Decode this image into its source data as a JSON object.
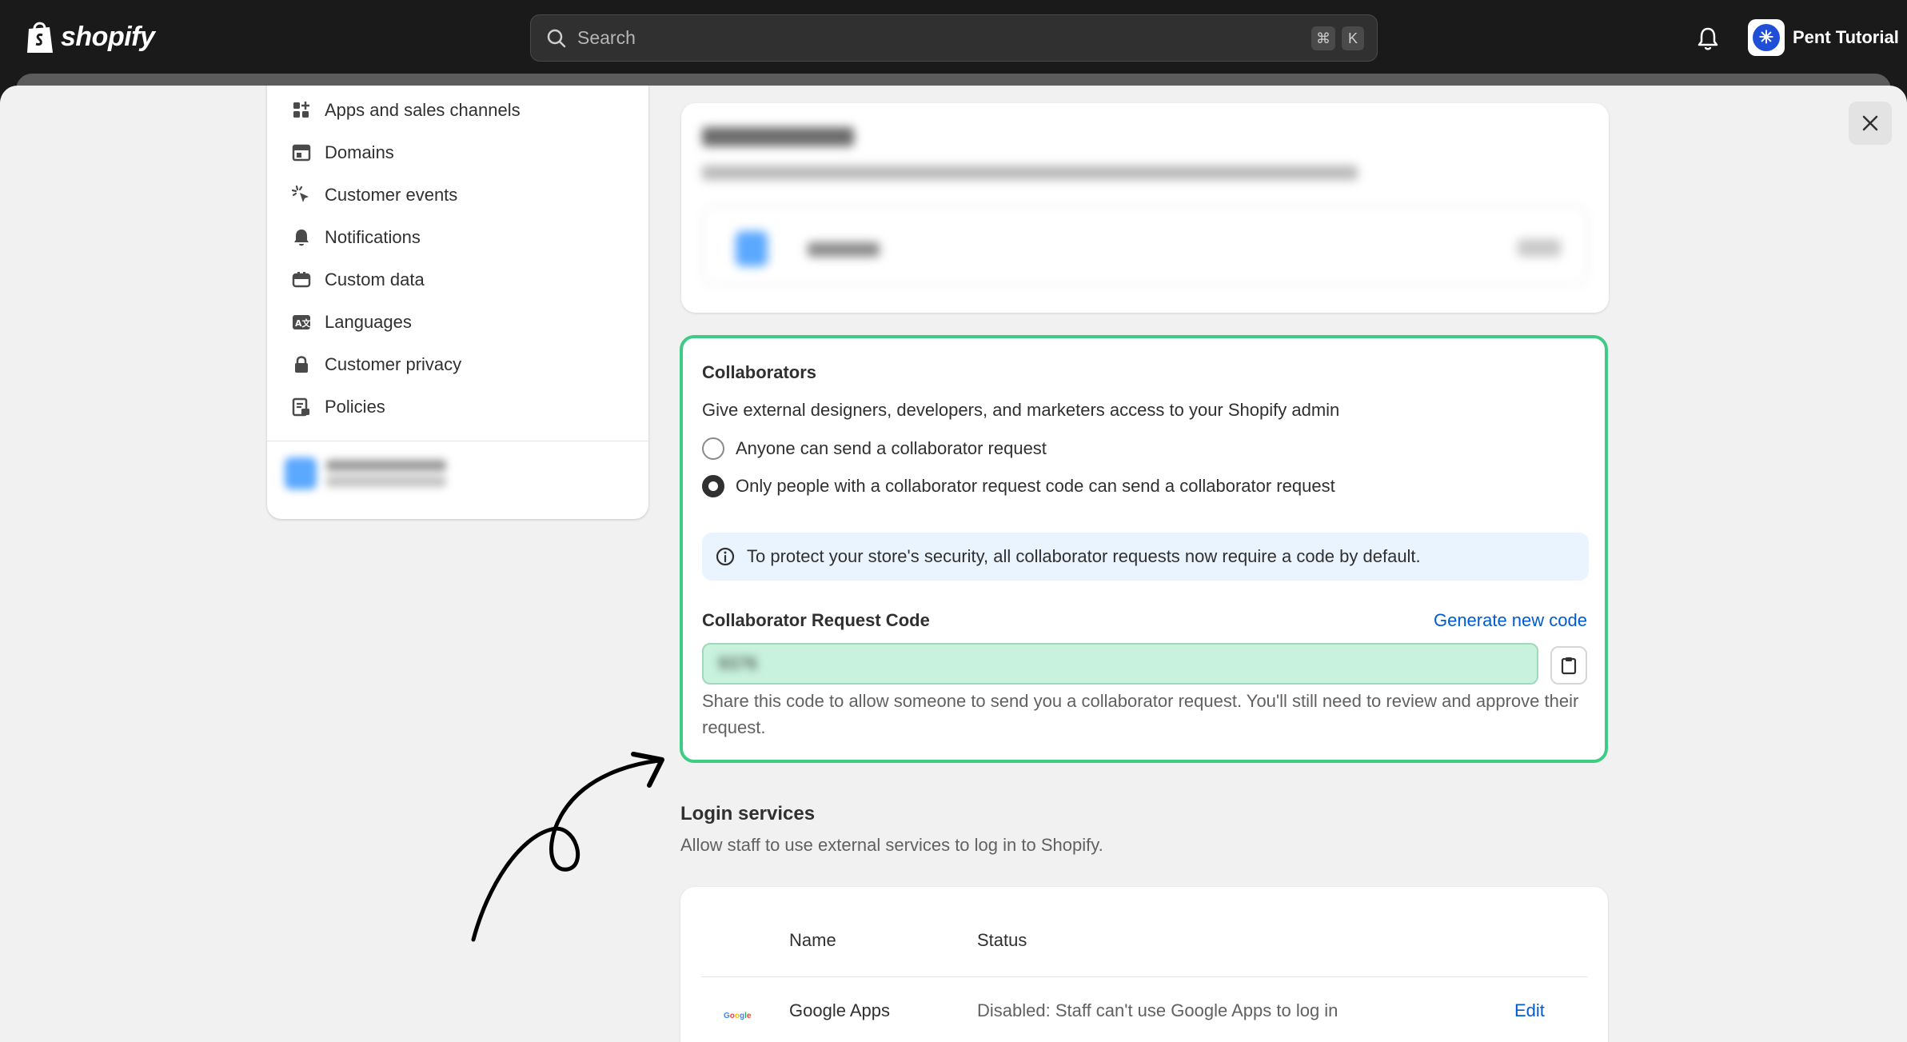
{
  "topbar": {
    "logo_text": "shopify",
    "search_placeholder": "Search",
    "shortcut_keys": [
      "⌘",
      "K"
    ],
    "store_name": "Pent Tutorial"
  },
  "sidebar": {
    "items": [
      {
        "label": "Apps and sales channels",
        "icon": "apps-icon"
      },
      {
        "label": "Domains",
        "icon": "domains-icon"
      },
      {
        "label": "Customer events",
        "icon": "cursor-click-icon"
      },
      {
        "label": "Notifications",
        "icon": "bell-icon"
      },
      {
        "label": "Custom data",
        "icon": "database-icon"
      },
      {
        "label": "Languages",
        "icon": "language-icon"
      },
      {
        "label": "Customer privacy",
        "icon": "lock-icon"
      },
      {
        "label": "Policies",
        "icon": "policy-icon"
      }
    ]
  },
  "collaborators": {
    "title": "Collaborators",
    "description": "Give external designers, developers, and marketers access to your Shopify admin",
    "options": [
      {
        "label": "Anyone can send a collaborator request",
        "checked": false
      },
      {
        "label": "Only people with a collaborator request code can send a collaborator request",
        "checked": true
      }
    ],
    "banner": "To protect your store's security, all collaborator requests now require a code by default.",
    "code_label": "Collaborator Request Code",
    "generate_link": "Generate new code",
    "code_value": "9376",
    "help_text": "Share this code to allow someone to send you a collaborator request. You'll still need to review and approve their request."
  },
  "login_services": {
    "title": "Login services",
    "description": "Allow staff to use external services to log in to Shopify.",
    "columns": [
      "Name",
      "Status"
    ],
    "rows": [
      {
        "logo": "Google",
        "name": "Google Apps",
        "status": "Disabled: Staff can't use Google Apps to log in",
        "action": "Edit"
      }
    ]
  },
  "colors": {
    "highlight_border": "#3ecb86",
    "code_field_bg": "#c8f2dd",
    "link": "#005bd3",
    "banner_bg": "#eaf4ff"
  }
}
